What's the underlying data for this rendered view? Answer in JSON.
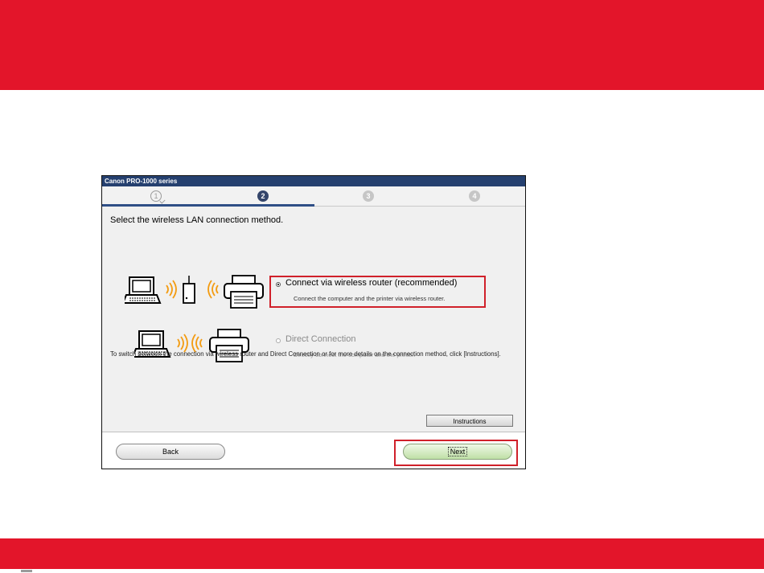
{
  "window": {
    "title": "Canon PRO-1000 series"
  },
  "steps": [
    {
      "label": "1",
      "state": "done"
    },
    {
      "label": "2",
      "state": "active"
    },
    {
      "label": "3",
      "state": "future"
    },
    {
      "label": "4",
      "state": "future"
    }
  ],
  "heading": "Select the wireless LAN connection method.",
  "options": {
    "router": {
      "title": "Connect via wireless router (recommended)",
      "description": "Connect the computer and the printer via wireless router.",
      "selected": true
    },
    "direct": {
      "title": "Direct Connection",
      "description": "Directly connect the computer and the printer.",
      "selected": false
    }
  },
  "note": "To switch between the connection via wireless router and Direct Connection or for more details on the connection method, click [Instructions].",
  "buttons": {
    "instructions": "Instructions",
    "back": "Back",
    "next": "Next"
  },
  "colors": {
    "brand_red": "#e3152a",
    "highlight_red": "#d0202a",
    "title_bar": "#25406f",
    "wifi_orange": "#f39c12"
  }
}
